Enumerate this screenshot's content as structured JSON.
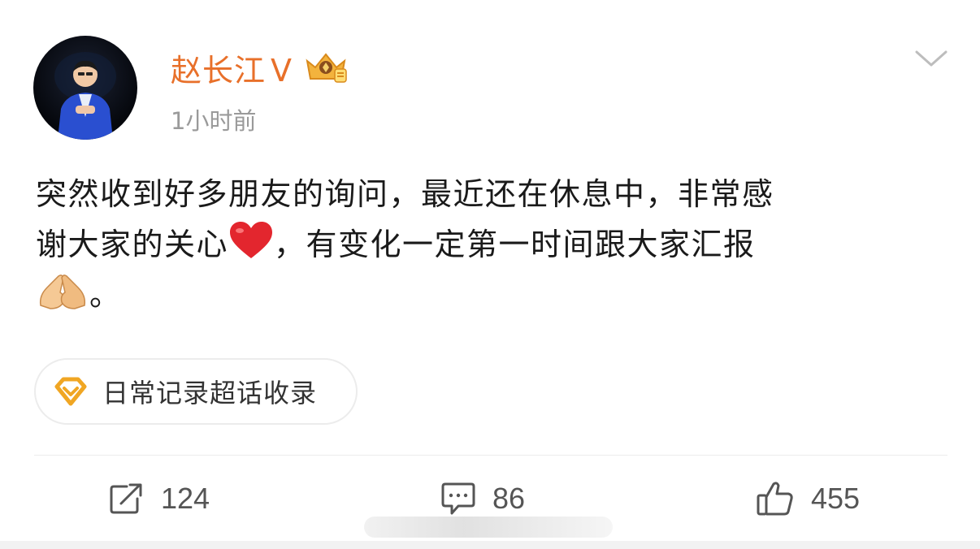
{
  "author": {
    "name": "赵长江",
    "verified_mark": "V",
    "badge_icon": "crown-badge-icon",
    "avatar_icon": "avatar-photo",
    "name_color": "#e8702a"
  },
  "post": {
    "time": "1小时前",
    "line1": "突然收到好多朋友的询问，最近还在休息中，非常感",
    "line2_a": "谢大家的关心",
    "line2_b": "，有变化一定第一时间跟大家汇报",
    "line3_end": "。",
    "emoji_heart": "red-heart-icon",
    "emoji_hands": "folded-hands-icon"
  },
  "topic": {
    "icon": "diamond-icon",
    "label": "日常记录超话收录"
  },
  "actions": {
    "repost": {
      "icon": "share-icon",
      "count": "124"
    },
    "comment": {
      "icon": "comment-icon",
      "count": "86"
    },
    "like": {
      "icon": "thumb-up-icon",
      "count": "455"
    }
  }
}
